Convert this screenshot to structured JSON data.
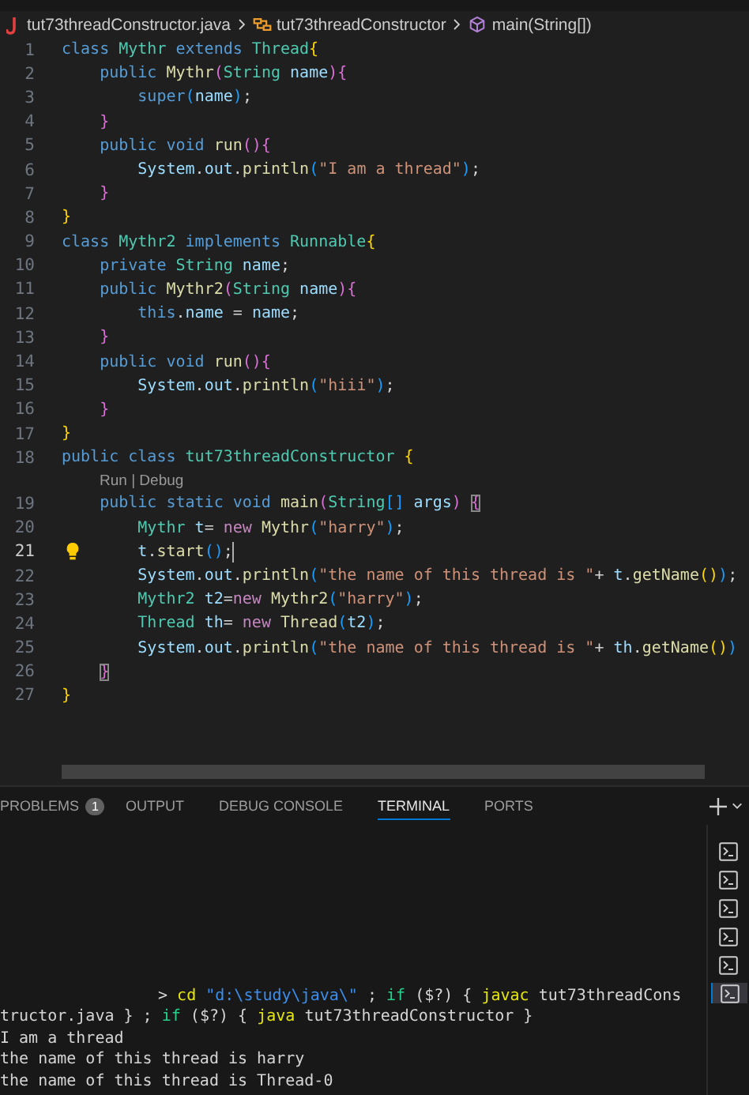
{
  "breadcrumb": [
    {
      "kind": "file",
      "text": "tut73threadConstructor.java"
    },
    {
      "kind": "class",
      "text": "tut73threadConstructor"
    },
    {
      "kind": "method",
      "text": "main(String[])"
    }
  ],
  "editor": {
    "lines": [
      {
        "kind": "code",
        "n": "1",
        "selected": false,
        "tokens": [
          {
            "kind": "kw",
            "text": "class "
          },
          {
            "kind": "type",
            "text": "Mythr "
          },
          {
            "kind": "kw",
            "text": "extends "
          },
          {
            "kind": "type",
            "text": "Thread"
          },
          {
            "kind": "b1",
            "text": "{"
          }
        ]
      },
      {
        "kind": "code",
        "n": "2",
        "selected": false,
        "tokens": [
          {
            "kind": "kw",
            "text": "    public "
          },
          {
            "kind": "fn",
            "text": "Mythr"
          },
          {
            "kind": "b2",
            "text": "("
          },
          {
            "kind": "type",
            "text": "String "
          },
          {
            "kind": "var",
            "text": "name"
          },
          {
            "kind": "b2",
            "text": "){"
          }
        ]
      },
      {
        "kind": "code",
        "n": "3",
        "selected": false,
        "tokens": [
          {
            "kind": "kw",
            "text": "        super"
          },
          {
            "kind": "b3",
            "text": "("
          },
          {
            "kind": "var",
            "text": "name"
          },
          {
            "kind": "b3",
            "text": ")"
          },
          {
            "kind": "p",
            "text": ";"
          }
        ]
      },
      {
        "kind": "code",
        "n": "4",
        "selected": false,
        "tokens": [
          {
            "kind": "b2",
            "text": "    }"
          }
        ]
      },
      {
        "kind": "code",
        "n": "5",
        "selected": false,
        "tokens": [
          {
            "kind": "kw",
            "text": "    public void "
          },
          {
            "kind": "fn",
            "text": "run"
          },
          {
            "kind": "b2",
            "text": "(){"
          }
        ]
      },
      {
        "kind": "code",
        "n": "6",
        "selected": false,
        "tokens": [
          {
            "kind": "var",
            "text": "        System"
          },
          {
            "kind": "p",
            "text": "."
          },
          {
            "kind": "var",
            "text": "out"
          },
          {
            "kind": "p",
            "text": "."
          },
          {
            "kind": "fn",
            "text": "println"
          },
          {
            "kind": "b3",
            "text": "("
          },
          {
            "kind": "str",
            "text": "\"I am a thread\""
          },
          {
            "kind": "b3",
            "text": ")"
          },
          {
            "kind": "p",
            "text": ";"
          }
        ]
      },
      {
        "kind": "code",
        "n": "7",
        "selected": false,
        "tokens": [
          {
            "kind": "b2",
            "text": "    }"
          }
        ]
      },
      {
        "kind": "code",
        "n": "8",
        "selected": false,
        "tokens": [
          {
            "kind": "b1",
            "text": "}"
          }
        ]
      },
      {
        "kind": "code",
        "n": "9",
        "selected": false,
        "tokens": [
          {
            "kind": "kw",
            "text": "class "
          },
          {
            "kind": "type",
            "text": "Mythr2 "
          },
          {
            "kind": "kw",
            "text": "implements "
          },
          {
            "kind": "type",
            "text": "Runnable"
          },
          {
            "kind": "b1",
            "text": "{"
          }
        ]
      },
      {
        "kind": "code",
        "n": "10",
        "selected": false,
        "tokens": [
          {
            "kind": "kw",
            "text": "    private "
          },
          {
            "kind": "type",
            "text": "String "
          },
          {
            "kind": "var",
            "text": "name"
          },
          {
            "kind": "p",
            "text": ";"
          }
        ]
      },
      {
        "kind": "code",
        "n": "11",
        "selected": false,
        "tokens": [
          {
            "kind": "kw",
            "text": "    public "
          },
          {
            "kind": "fn",
            "text": "Mythr2"
          },
          {
            "kind": "b2",
            "text": "("
          },
          {
            "kind": "type",
            "text": "String "
          },
          {
            "kind": "var",
            "text": "name"
          },
          {
            "kind": "b2",
            "text": "){"
          }
        ]
      },
      {
        "kind": "code",
        "n": "12",
        "selected": false,
        "tokens": [
          {
            "kind": "kw",
            "text": "        this"
          },
          {
            "kind": "p",
            "text": "."
          },
          {
            "kind": "var",
            "text": "name"
          },
          {
            "kind": "p",
            "text": " = "
          },
          {
            "kind": "var",
            "text": "name"
          },
          {
            "kind": "p",
            "text": ";"
          }
        ]
      },
      {
        "kind": "code",
        "n": "13",
        "selected": false,
        "tokens": [
          {
            "kind": "b2",
            "text": "    }"
          }
        ]
      },
      {
        "kind": "code",
        "n": "14",
        "selected": false,
        "tokens": [
          {
            "kind": "kw",
            "text": "    public void "
          },
          {
            "kind": "fn",
            "text": "run"
          },
          {
            "kind": "b2",
            "text": "(){"
          }
        ]
      },
      {
        "kind": "code",
        "n": "15",
        "selected": false,
        "tokens": [
          {
            "kind": "var",
            "text": "        System"
          },
          {
            "kind": "p",
            "text": "."
          },
          {
            "kind": "var",
            "text": "out"
          },
          {
            "kind": "p",
            "text": "."
          },
          {
            "kind": "fn",
            "text": "println"
          },
          {
            "kind": "b3",
            "text": "("
          },
          {
            "kind": "str",
            "text": "\"hiii\""
          },
          {
            "kind": "b3",
            "text": ")"
          },
          {
            "kind": "p",
            "text": ";"
          }
        ]
      },
      {
        "kind": "code",
        "n": "16",
        "selected": false,
        "tokens": [
          {
            "kind": "b2",
            "text": "    }"
          }
        ]
      },
      {
        "kind": "code",
        "n": "17",
        "selected": false,
        "tokens": [
          {
            "kind": "b1",
            "text": "}"
          }
        ]
      },
      {
        "kind": "code",
        "n": "18",
        "selected": false,
        "tokens": [
          {
            "kind": "kw",
            "text": "public class "
          },
          {
            "kind": "type",
            "text": "tut73threadConstructor "
          },
          {
            "kind": "b1",
            "text": "{"
          }
        ]
      },
      {
        "kind": "codelens",
        "text": "Run | Debug"
      },
      {
        "kind": "code",
        "n": "19",
        "selected": false,
        "tokens": [
          {
            "kind": "kw",
            "text": "    public static void "
          },
          {
            "kind": "fn",
            "text": "main"
          },
          {
            "kind": "b2",
            "text": "("
          },
          {
            "kind": "type",
            "text": "String"
          },
          {
            "kind": "b3",
            "text": "[]"
          },
          {
            "kind": "var",
            "text": " args"
          },
          {
            "kind": "b2",
            "text": ") "
          },
          {
            "kind": "match",
            "text": "{"
          }
        ]
      },
      {
        "kind": "code",
        "n": "20",
        "selected": false,
        "tokens": [
          {
            "kind": "type",
            "text": "        Mythr "
          },
          {
            "kind": "var",
            "text": "t"
          },
          {
            "kind": "p",
            "text": "= "
          },
          {
            "kind": "new",
            "text": "new "
          },
          {
            "kind": "fn",
            "text": "Mythr"
          },
          {
            "kind": "b3",
            "text": "("
          },
          {
            "kind": "str",
            "text": "\"harry\""
          },
          {
            "kind": "b3",
            "text": ")"
          },
          {
            "kind": "p",
            "text": ";"
          }
        ]
      },
      {
        "kind": "code",
        "n": "21",
        "selected": true,
        "tokens": [
          {
            "kind": "var",
            "text": "        t"
          },
          {
            "kind": "p",
            "text": "."
          },
          {
            "kind": "fn",
            "text": "start"
          },
          {
            "kind": "b3",
            "text": "()"
          },
          {
            "kind": "p",
            "text": ";"
          }
        ]
      },
      {
        "kind": "code",
        "n": "22",
        "selected": false,
        "tokens": [
          {
            "kind": "var",
            "text": "        System"
          },
          {
            "kind": "p",
            "text": "."
          },
          {
            "kind": "var",
            "text": "out"
          },
          {
            "kind": "p",
            "text": "."
          },
          {
            "kind": "fn",
            "text": "println"
          },
          {
            "kind": "b3",
            "text": "("
          },
          {
            "kind": "str",
            "text": "\"the name of this thread is \""
          },
          {
            "kind": "p",
            "text": "+ "
          },
          {
            "kind": "var",
            "text": "t"
          },
          {
            "kind": "p",
            "text": "."
          },
          {
            "kind": "fn",
            "text": "getName"
          },
          {
            "kind": "b1",
            "text": "()"
          },
          {
            "kind": "b3",
            "text": ")"
          },
          {
            "kind": "p",
            "text": ";"
          }
        ]
      },
      {
        "kind": "code",
        "n": "23",
        "selected": false,
        "tokens": [
          {
            "kind": "type",
            "text": "        Mythr2 "
          },
          {
            "kind": "var",
            "text": "t2"
          },
          {
            "kind": "p",
            "text": "="
          },
          {
            "kind": "new",
            "text": "new "
          },
          {
            "kind": "fn",
            "text": "Mythr2"
          },
          {
            "kind": "b3",
            "text": "("
          },
          {
            "kind": "str",
            "text": "\"harry\""
          },
          {
            "kind": "b3",
            "text": ")"
          },
          {
            "kind": "p",
            "text": ";"
          }
        ]
      },
      {
        "kind": "code",
        "n": "24",
        "selected": false,
        "tokens": [
          {
            "kind": "type",
            "text": "        Thread "
          },
          {
            "kind": "var",
            "text": "th"
          },
          {
            "kind": "p",
            "text": "= "
          },
          {
            "kind": "new",
            "text": "new "
          },
          {
            "kind": "fn",
            "text": "Thread"
          },
          {
            "kind": "b3",
            "text": "("
          },
          {
            "kind": "var",
            "text": "t2"
          },
          {
            "kind": "b3",
            "text": ")"
          },
          {
            "kind": "p",
            "text": ";"
          }
        ]
      },
      {
        "kind": "code",
        "n": "25",
        "selected": false,
        "tokens": [
          {
            "kind": "var",
            "text": "        System"
          },
          {
            "kind": "p",
            "text": "."
          },
          {
            "kind": "var",
            "text": "out"
          },
          {
            "kind": "p",
            "text": "."
          },
          {
            "kind": "fn",
            "text": "println"
          },
          {
            "kind": "b3",
            "text": "("
          },
          {
            "kind": "str",
            "text": "\"the name of this thread is \""
          },
          {
            "kind": "p",
            "text": "+ "
          },
          {
            "kind": "var",
            "text": "th"
          },
          {
            "kind": "p",
            "text": "."
          },
          {
            "kind": "fn",
            "text": "getName"
          },
          {
            "kind": "b1",
            "text": "()"
          },
          {
            "kind": "b3",
            "text": ")"
          }
        ]
      },
      {
        "kind": "code",
        "n": "26",
        "selected": false,
        "tokens": [
          {
            "kind": "match",
            "text": "    }"
          }
        ]
      },
      {
        "kind": "code",
        "n": "27",
        "selected": false,
        "tokens": [
          {
            "kind": "b1",
            "text": "}"
          }
        ]
      }
    ]
  },
  "panel": {
    "tabs": [
      {
        "label": "PROBLEMS",
        "badge": "1",
        "selected": false
      },
      {
        "label": "OUTPUT",
        "selected": false
      },
      {
        "label": "DEBUG CONSOLE",
        "selected": false
      },
      {
        "label": "TERMINAL",
        "selected": true
      },
      {
        "label": "PORTS",
        "selected": false
      }
    ],
    "terminals": [
      {
        "selected": false
      },
      {
        "selected": false
      },
      {
        "selected": false
      },
      {
        "selected": false
      },
      {
        "selected": false
      },
      {
        "selected": true
      }
    ],
    "lines": [
      {
        "kind": "command",
        "tokens": [
          {
            "kind": "p",
            "text": "> "
          },
          {
            "kind": "cmd",
            "text": "cd "
          },
          {
            "kind": "tstr",
            "text": "\"d:\\study\\java\\\""
          },
          {
            "kind": "p",
            "text": " ; "
          },
          {
            "kind": "ctl",
            "text": "if "
          },
          {
            "kind": "p",
            "text": "($?) { "
          },
          {
            "kind": "cmd",
            "text": "javac "
          },
          {
            "kind": "p",
            "text": "tut73threadCons"
          }
        ]
      },
      {
        "kind": "output",
        "tokens": [
          {
            "kind": "p",
            "text": "tructor.java } ; "
          },
          {
            "kind": "ctl",
            "text": "if "
          },
          {
            "kind": "p",
            "text": "($?) { "
          },
          {
            "kind": "cmd",
            "text": "java "
          },
          {
            "kind": "p",
            "text": "tut73threadConstructor }"
          }
        ]
      },
      {
        "kind": "output",
        "tokens": [
          {
            "kind": "p",
            "text": "I am a thread"
          }
        ]
      },
      {
        "kind": "output",
        "tokens": [
          {
            "kind": "p",
            "text": "the name of this thread is harry"
          }
        ]
      },
      {
        "kind": "output",
        "tokens": [
          {
            "kind": "p",
            "text": "the name of this thread is Thread-0"
          }
        ]
      }
    ]
  }
}
